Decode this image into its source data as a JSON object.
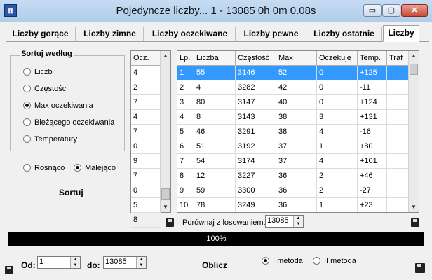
{
  "window": {
    "title": "Pojedyncze liczby... 1 - 13085   0h 0m 0.08s",
    "app_icon": "dice-icon",
    "controls": {
      "minimize": "▭",
      "maximize": "▢",
      "close": "✕"
    }
  },
  "tabs": [
    {
      "label": "Liczby gorące"
    },
    {
      "label": "Liczby zimne"
    },
    {
      "label": "Liczby oczekiwane"
    },
    {
      "label": "Liczby pewne"
    },
    {
      "label": "Liczby ostatnie"
    },
    {
      "label": "Liczby",
      "active": true
    }
  ],
  "sort_group": {
    "title": "Sortuj według",
    "options": [
      {
        "label": "Liczb",
        "selected": false
      },
      {
        "label": "Częstości",
        "selected": false
      },
      {
        "label": "Max oczekiwania",
        "selected": true
      },
      {
        "label": "Bieżącego oczekiwania",
        "selected": false
      },
      {
        "label": "Temperatury",
        "selected": false
      }
    ],
    "order": [
      {
        "label": "Rosnąco",
        "selected": false
      },
      {
        "label": "Malejąco",
        "selected": true
      }
    ],
    "sort_button": "Sortuj"
  },
  "occ_list": {
    "header": "Ocz.",
    "values": [
      "4",
      "2",
      "7",
      "4",
      "7",
      "0",
      "9",
      "7",
      "0",
      "5",
      "8"
    ]
  },
  "results": {
    "columns": [
      "Lp.",
      "Liczba",
      "Częstość",
      "Max",
      "Oczekuje",
      "Temp.",
      "Traf"
    ],
    "rows": [
      [
        "1",
        "55",
        "3146",
        "52",
        "0",
        "+125",
        ""
      ],
      [
        "2",
        "4",
        "3282",
        "42",
        "0",
        "-11",
        ""
      ],
      [
        "3",
        "80",
        "3147",
        "40",
        "0",
        "+124",
        ""
      ],
      [
        "4",
        "8",
        "3143",
        "38",
        "3",
        "+131",
        ""
      ],
      [
        "5",
        "46",
        "3291",
        "38",
        "4",
        "-16",
        ""
      ],
      [
        "6",
        "51",
        "3192",
        "37",
        "1",
        "+80",
        ""
      ],
      [
        "7",
        "54",
        "3174",
        "37",
        "4",
        "+101",
        ""
      ],
      [
        "8",
        "12",
        "3227",
        "36",
        "2",
        "+46",
        ""
      ],
      [
        "9",
        "59",
        "3300",
        "36",
        "2",
        "-27",
        ""
      ],
      [
        "10",
        "78",
        "3249",
        "36",
        "1",
        "+23",
        ""
      ]
    ],
    "selected_row": 0
  },
  "compare": {
    "label": "Porównaj z losowaniem:",
    "value": "13085"
  },
  "progress": {
    "value": 100,
    "text": "100%"
  },
  "range": {
    "from_label": "Od:",
    "from_value": "1",
    "to_label": "do:",
    "to_value": "13085"
  },
  "compute_button": "Oblicz",
  "methods": [
    {
      "label": "I metoda",
      "selected": true
    },
    {
      "label": "II metoda",
      "selected": false
    }
  ],
  "colors": {
    "selection": "#3399ff",
    "progress": "#000000"
  }
}
